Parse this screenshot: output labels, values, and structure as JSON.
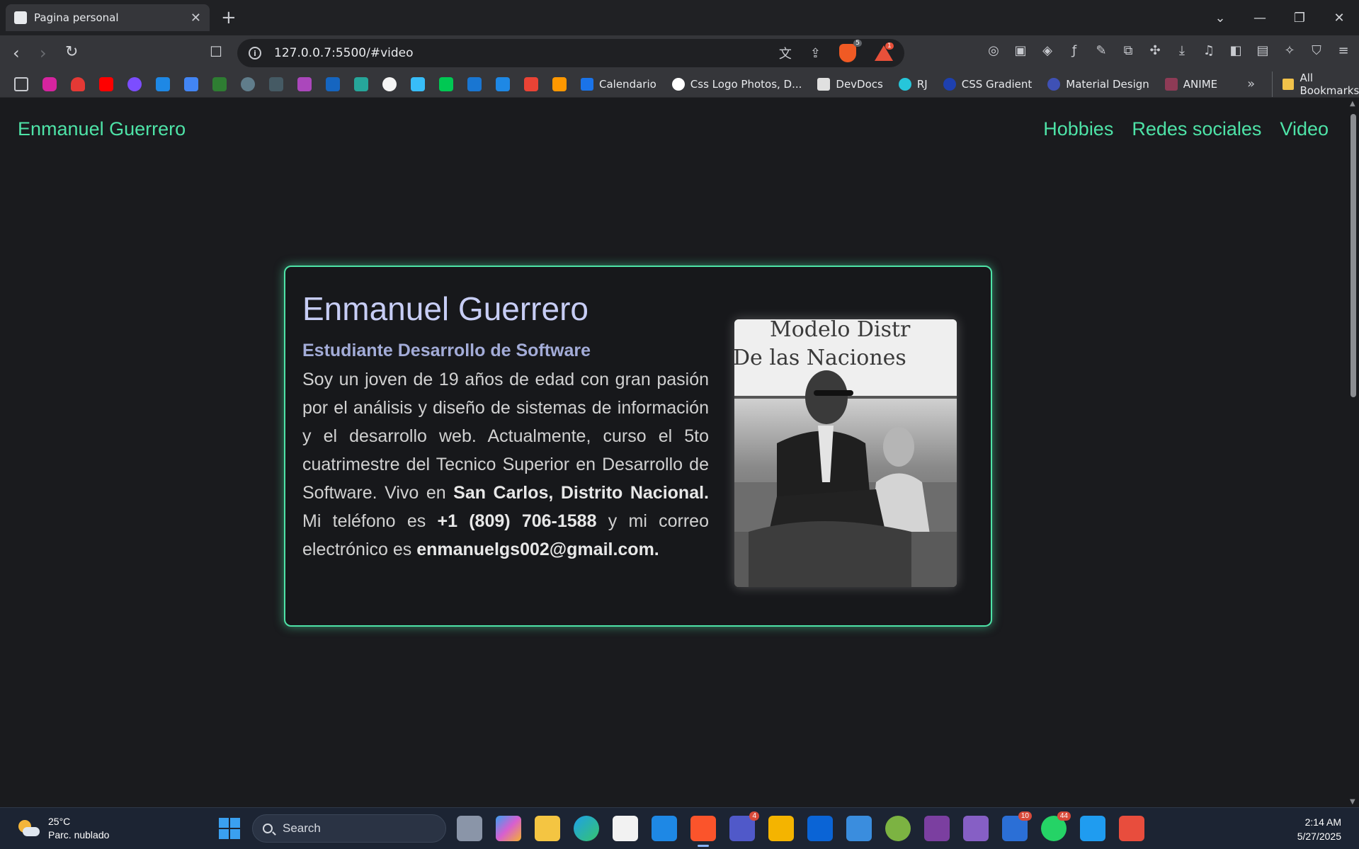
{
  "browser": {
    "tab_title": "Pagina personal",
    "url": "127.0.0.7:5500/#video",
    "brave_shield_count": "5",
    "rewards_count": "1"
  },
  "bookmarks": {
    "items": [
      "Calendario",
      "Css Logo Photos, D...",
      "DevDocs",
      "RJ",
      "CSS Gradient",
      "Material Design",
      "ANIME"
    ],
    "all_label": "All Bookmarks"
  },
  "site": {
    "brand": "Enmanuel Guerrero",
    "nav": [
      "Hobbies",
      "Redes sociales",
      "Video"
    ]
  },
  "card": {
    "name": "Enmanuel Guerrero",
    "subtitle": "Estudiante Desarrollo de Software",
    "bio_part1": "Soy un joven de 19 años de edad con gran pasión por el análisis y diseño de sistemas de información y el desarrollo web. Actualmente, curso el 5to cuatrimestre del Tecnico Superior en Desarrollo de Software. Vivo en ",
    "bio_location": "San Carlos, Distrito Nacional.",
    "bio_part2": " Mi teléfono es ",
    "bio_phone": "+1 (809) 706-1588",
    "bio_part3": " y mi correo electrónico es ",
    "bio_email": "enmanuelgs002@gmail.com.",
    "photo_sign_line1": "Modelo Distr",
    "photo_sign_line2": "De las Naciones"
  },
  "taskbar": {
    "temperature": "25°C",
    "weather": "Parc. nublado",
    "search_placeholder": "Search",
    "time": "2:14 AM",
    "date": "5/27/2025",
    "badges": {
      "teams": "4",
      "todo": "10",
      "whatsapp": "44"
    }
  },
  "colors": {
    "accent": "#4ee3a7",
    "name": "#c7cdf5",
    "subtitle": "#a3acd8",
    "background": "#1a1b1e"
  }
}
